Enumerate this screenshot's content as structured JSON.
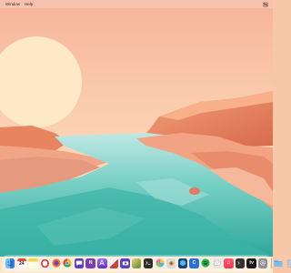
{
  "menubar": {
    "items": [
      "Window",
      "Help"
    ],
    "control_center_icon": "control-center-icon"
  },
  "wallpaper": {
    "description_colors": {
      "sky_top": "#f6b79d",
      "sky_bottom": "#fde6c8",
      "sun": "#fff3d6",
      "rock": "#e9835e",
      "water": "#4fc0b2"
    }
  },
  "dock": {
    "icons": [
      {
        "name": "finder-icon",
        "color": "#3d8ee8"
      },
      {
        "name": "calendar-icon",
        "day": "24"
      },
      {
        "name": "notes-icon",
        "color": "#f6d24b"
      },
      {
        "name": "opera-icon",
        "color": "#e53935"
      },
      {
        "name": "firefox-icon",
        "color": "#f07a1c"
      },
      {
        "name": "chrome-icon",
        "color": "#34a853"
      },
      {
        "name": "chat-icon",
        "color": "#5b3fb7"
      },
      {
        "name": "onenote-icon",
        "color": "#7b3fb2"
      },
      {
        "name": "appstore-icon",
        "color": "#7a4bd8"
      },
      {
        "name": "maps-icon",
        "color": "#c8423c"
      },
      {
        "name": "camera-icon",
        "color": "#5e3fc4"
      },
      {
        "name": "photos-icon",
        "color": "#5a7d3c"
      },
      {
        "name": "terminal-icon",
        "color": "#2d2d2d"
      },
      {
        "name": "color-wheel-icon",
        "color": "#e96bb6"
      },
      {
        "name": "blender-icon",
        "color": "#d9dadb"
      },
      {
        "name": "hex-app-icon",
        "color": "#1f3f7a"
      },
      {
        "name": "c-app-icon",
        "color": "#2e6ed8"
      },
      {
        "name": "spotify-icon",
        "color": "#1db954"
      },
      {
        "name": "mail-icon",
        "color": "#d8d8d8"
      },
      {
        "name": "music-icon",
        "color": "#f04a5c"
      },
      {
        "name": "terminal2-icon",
        "color": "#333333"
      },
      {
        "name": "appletv-icon",
        "color": "#1a1a1a"
      },
      {
        "name": "settings-icon",
        "color": "#8e8e93"
      },
      {
        "name": "folder-icon",
        "color": "#4ba6ef"
      },
      {
        "name": "trash-icon",
        "color": "#b7c2cc"
      }
    ]
  }
}
